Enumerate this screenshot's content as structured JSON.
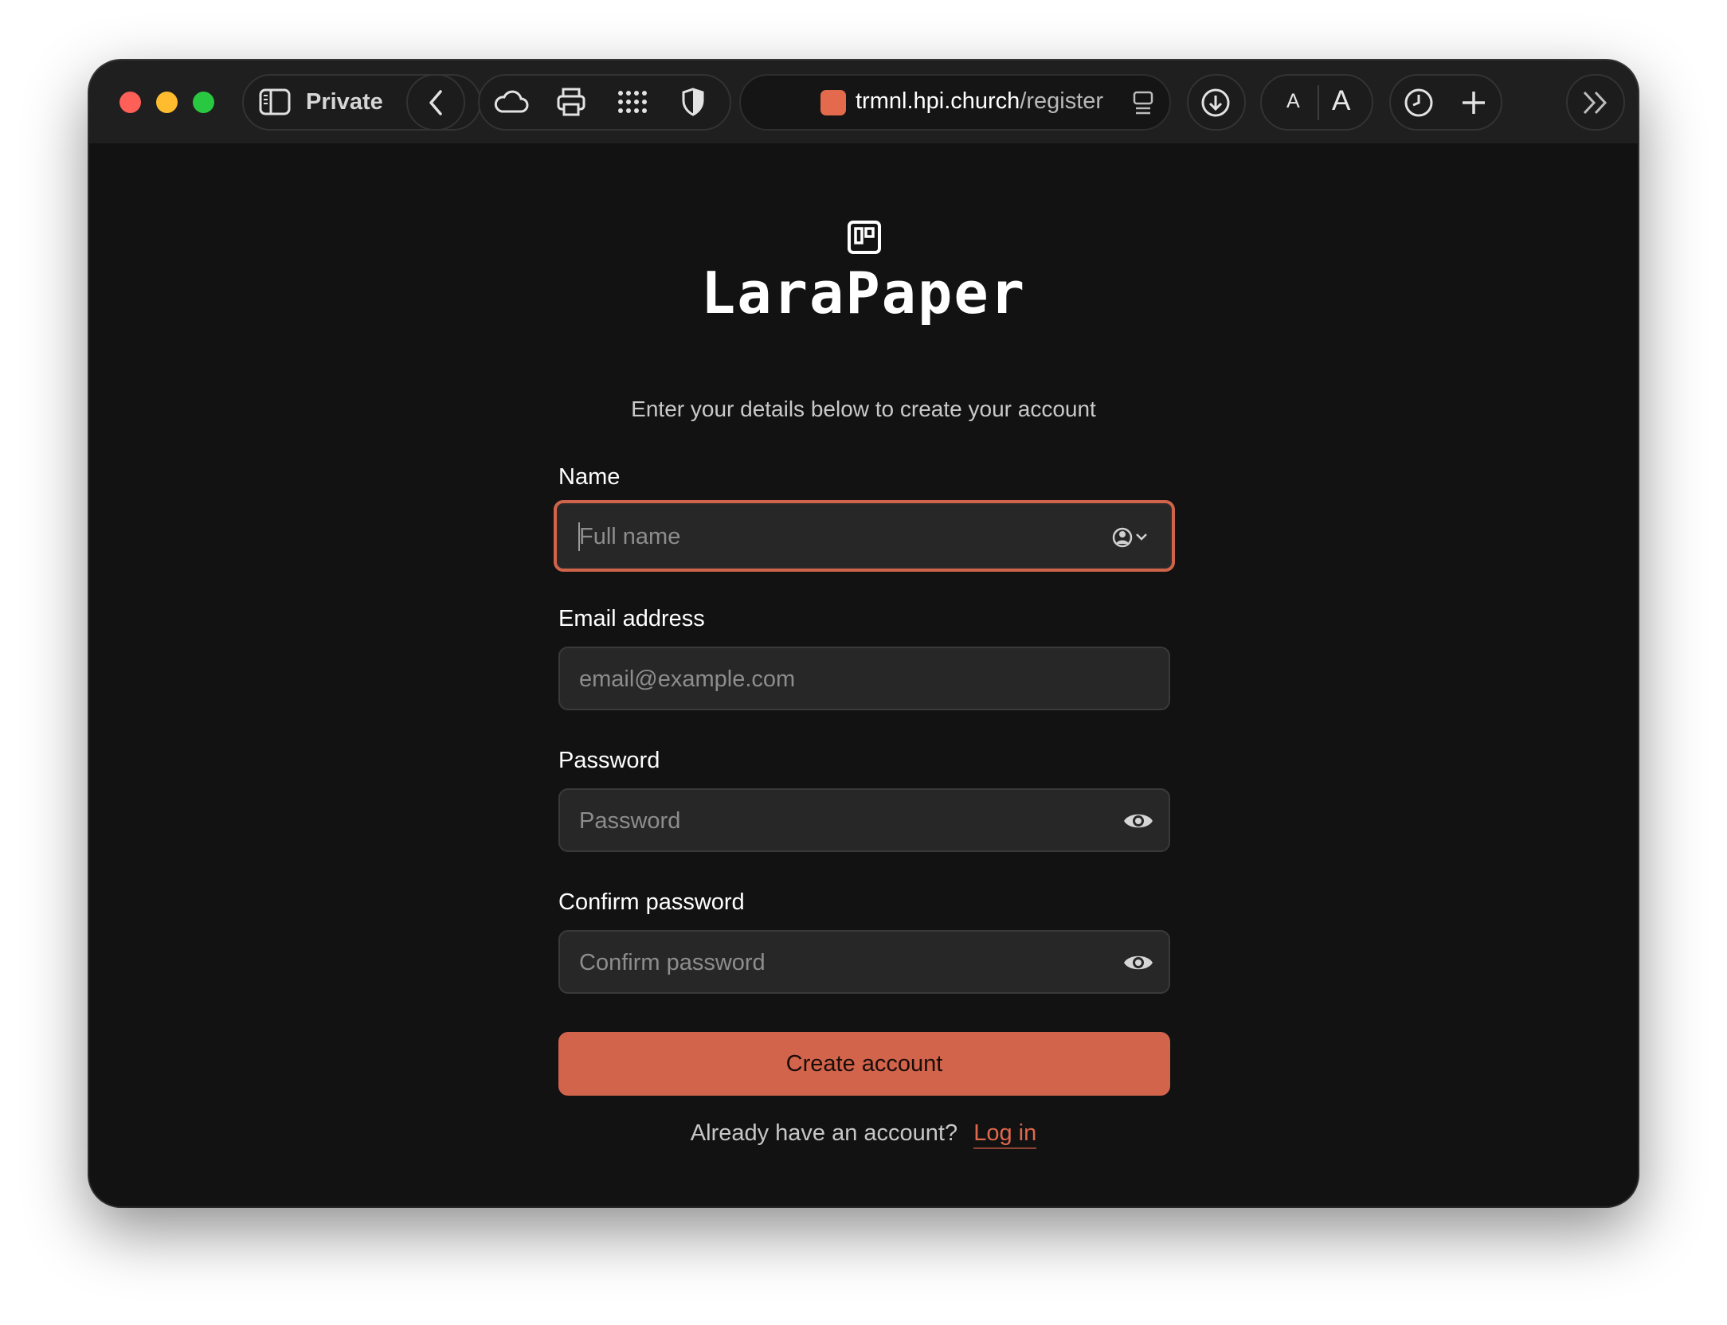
{
  "browser": {
    "private_label": "Private",
    "url_host": "trmnl.hpi.church",
    "url_path": "/register",
    "font_small": "A",
    "font_large": "A",
    "accent": "#e36a4c"
  },
  "page": {
    "brand": "LaraPaper",
    "subtitle": "Enter your details below to create your account",
    "accent": "#d2644c"
  },
  "form": {
    "name_label": "Name",
    "name_placeholder": "Full name",
    "email_label": "Email address",
    "email_placeholder": "email@example.com",
    "password_label": "Password",
    "password_placeholder": "Password",
    "confirm_label": "Confirm password",
    "confirm_placeholder": "Confirm password",
    "submit_label": "Create account"
  },
  "footer": {
    "prompt": "Already have an account?",
    "login_link": "Log in"
  }
}
